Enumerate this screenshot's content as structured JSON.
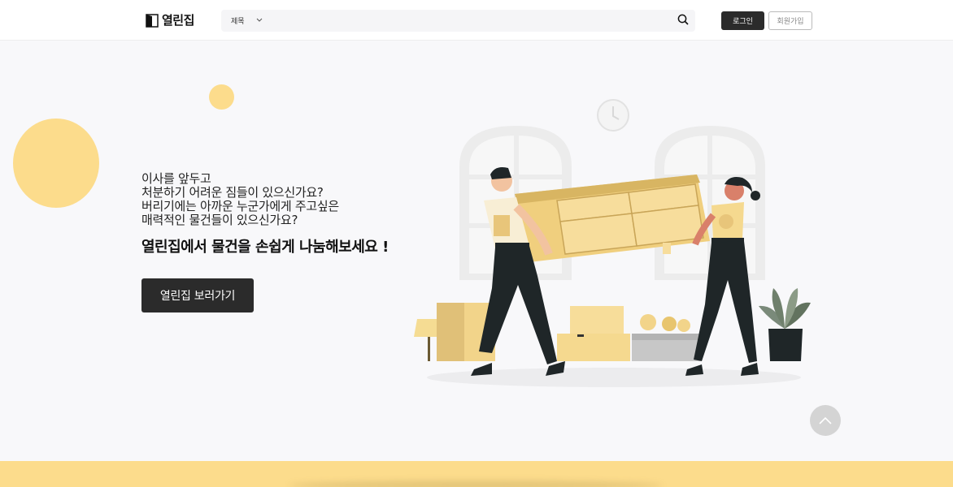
{
  "header": {
    "logo_text": "열린집",
    "search": {
      "select_value": "제목",
      "placeholder": ""
    },
    "login_label": "로그인",
    "signup_label": "회원가입"
  },
  "hero": {
    "lines": [
      "이사를 앞두고",
      "처분하기 어려운 짐들이 있으신가요?",
      "버리기에는 아까운 누군가에게 주고싶은",
      "매력적인 물건들이 있으신가요?"
    ],
    "title": "열린집에서 물건을 손쉽게 나눔해보세요 !",
    "cta_label": "열린집 보러가기"
  },
  "colors": {
    "accent": "#fcdc8c",
    "dark": "#2b2b2b",
    "background": "#f8f8fa"
  },
  "icons": {
    "logo": "door-icon",
    "search": "search-icon",
    "select": "chevron-down-icon",
    "scroll_top": "chevron-up-icon"
  }
}
